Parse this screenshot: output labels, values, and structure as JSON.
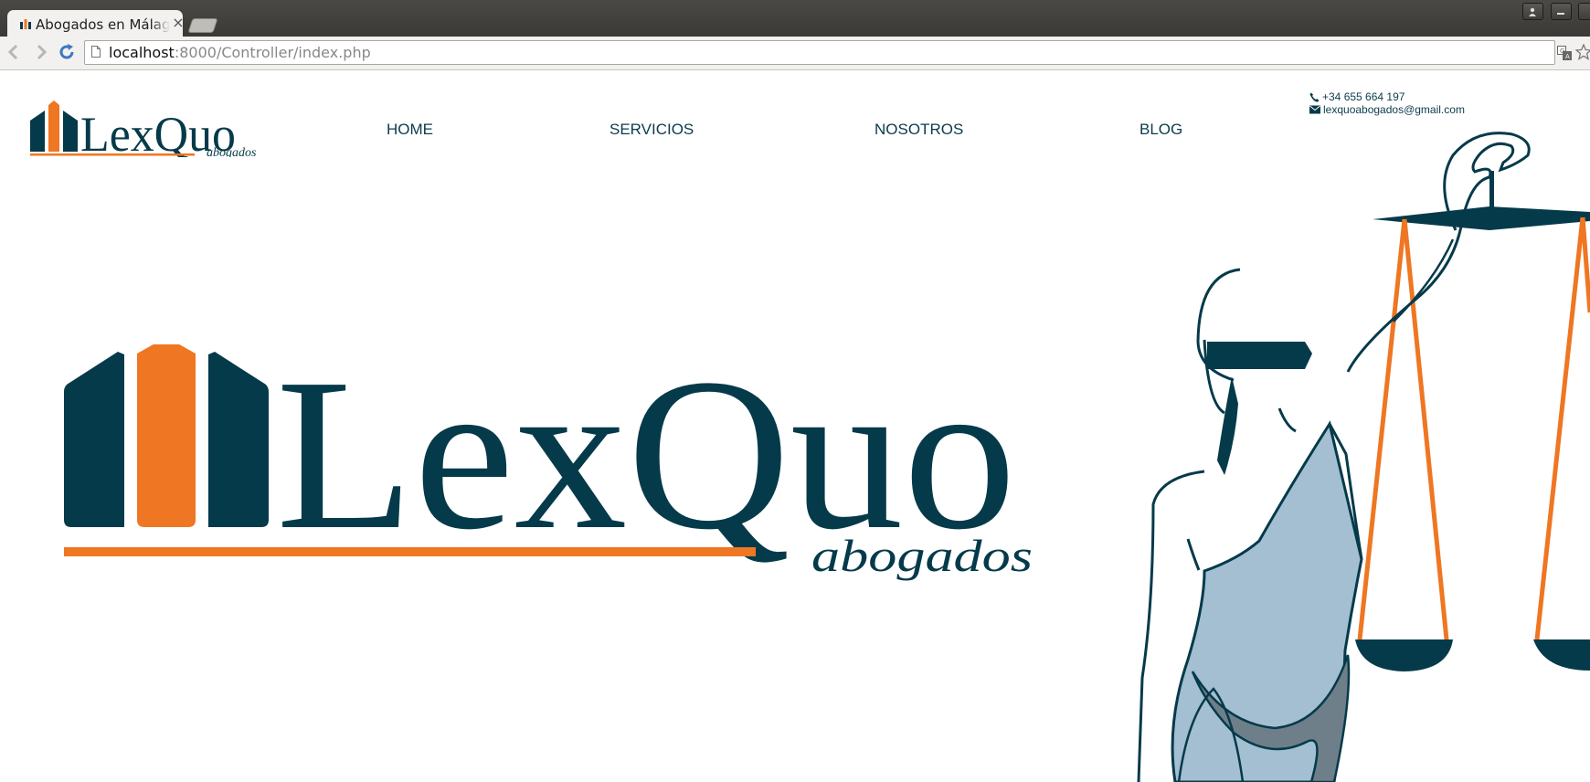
{
  "browser": {
    "tab_title": "Abogados en Málaga",
    "tab_close": "×",
    "url_host": "localhost",
    "url_path": ":8000/Controller/index.php"
  },
  "header": {
    "logo": {
      "name": "LexQuo",
      "tagline": "abogados"
    },
    "nav": [
      "HOME",
      "SERVICIOS",
      "NOSOTROS",
      "BLOG"
    ],
    "phone": "+34 655 664 197",
    "email": "lexquoabogados@gmail.com"
  },
  "hero": {
    "logo": {
      "name": "LexQuo",
      "tagline": "abogados"
    }
  },
  "colors": {
    "brand_teal": "#053a4a",
    "brand_orange": "#ef7622",
    "robe_blue": "#a4bfd1",
    "robe_shadow": "#6f7f8a"
  }
}
